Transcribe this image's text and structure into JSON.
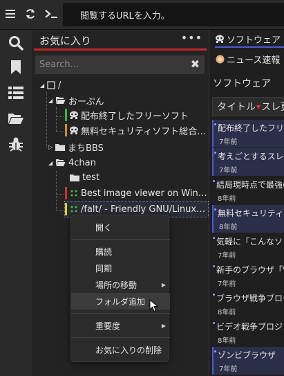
{
  "toolbar": {
    "url_placeholder": "閲覧するURLを入力。",
    "icons": [
      "menu-icon",
      "reload-icon",
      "terminal-icon"
    ]
  },
  "activity": [
    "search-icon",
    "bookmark-icon",
    "list-icon",
    "folder-icon",
    "bug-icon"
  ],
  "favorites": {
    "title": "お気に入り",
    "more": "•••",
    "search_placeholder": "Search...",
    "tree": {
      "root": "/",
      "folder1": "おーぷん",
      "item1": "配布終了したフリーソフト",
      "item2": "無料セキュリティソフト総合…",
      "folder2": "まちBBS",
      "folder3": "4chan",
      "folder4": "test",
      "item3": "Best image viewer on Win…",
      "item4": "/falt/ - Friendly GNU/Linux…"
    }
  },
  "board": {
    "tab1": "ソフトウェア",
    "tab2": "ニュース速報",
    "title": "ソフトウェア",
    "sort_label": "タイトル",
    "sort_suffix": "スレ更",
    "threads": [
      {
        "title": "配布終了したフリー",
        "age": "7年前"
      },
      {
        "title": "考えごとするスレ",
        "age": "7年前"
      },
      {
        "title": "結局現時点で最強の",
        "age": "8年前"
      },
      {
        "title": "無料セキュリティソ",
        "age": "8年前"
      },
      {
        "title": "気軽に「こんなソフ",
        "age": "7年前"
      },
      {
        "title": "新手のブラウザ「V",
        "age": "7年前"
      },
      {
        "title": "ブラウザ戦争ブロー",
        "age": "8年前"
      },
      {
        "title": "ビデオ戦争ブロジェ",
        "age": "8年前"
      },
      {
        "title": "ゾンビブラウザ",
        "age": "7年前"
      }
    ]
  },
  "menu": {
    "open": "開く",
    "subscribe": "購読",
    "sync": "同期",
    "move": "場所の移動",
    "add_folder": "フォルダ追加",
    "importance": "重要度",
    "delete": "お気に入りの削除"
  },
  "colors": {
    "accent_red": "#c62828",
    "green_stripe": "#2fb84a",
    "orange_stripe": "#e08a1e",
    "red_stripe": "#d32f2f",
    "yellow_stripe": "#e8d21a"
  }
}
